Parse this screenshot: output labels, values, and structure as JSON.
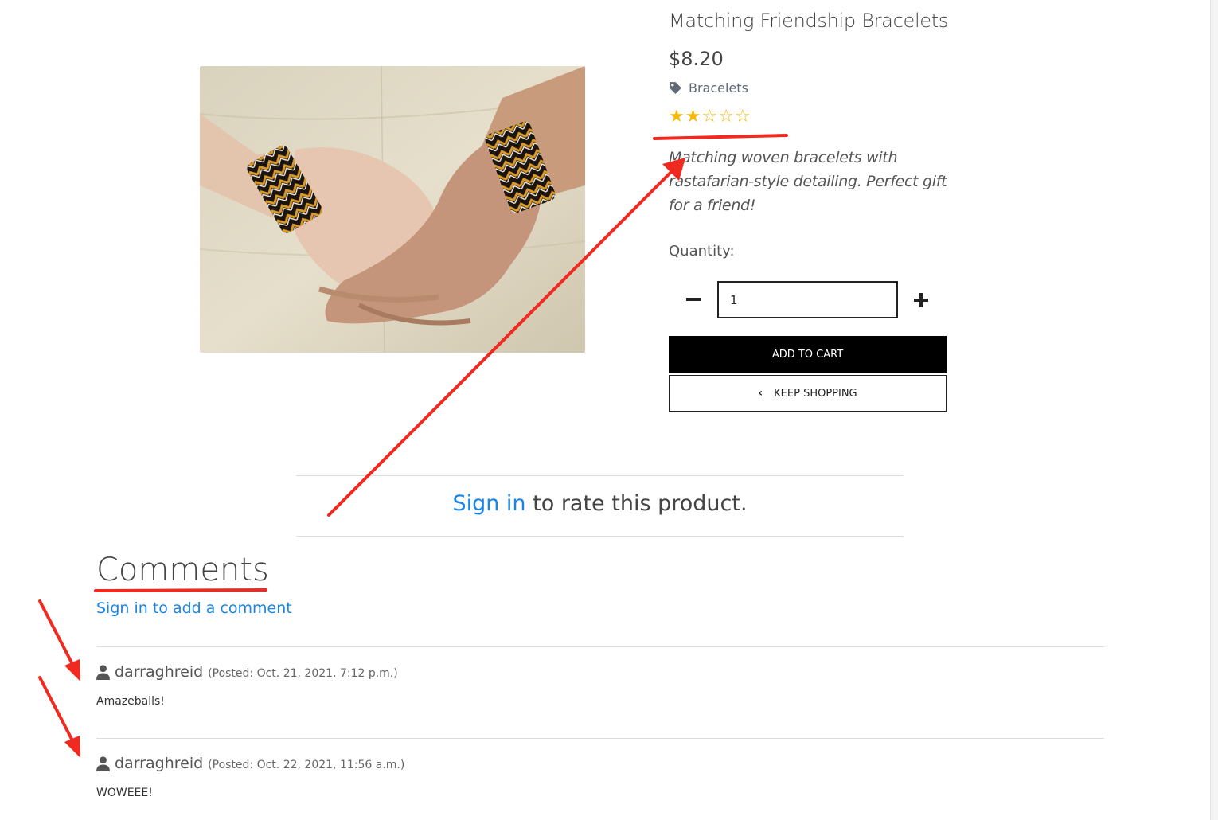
{
  "product": {
    "title": "Matching Friendship Bracelets",
    "price": "$8.20",
    "category": "Bracelets",
    "rating": 2,
    "rating_max": 5,
    "description": "Matching woven bracelets with rastafarian-style detailing. Perfect gift for a friend!",
    "image_alt": "Two hands wearing matching woven friendship bracelets"
  },
  "quantity": {
    "label": "Quantity:",
    "value": "1"
  },
  "buttons": {
    "add_to_cart": "ADD TO CART",
    "keep_shopping": "KEEP SHOPPING"
  },
  "rate": {
    "link_text": "Sign in",
    "rest_text": " to rate this product."
  },
  "comments": {
    "heading": "Comments",
    "add_link": "Sign in to add a comment",
    "items": [
      {
        "user": "darraghreid",
        "posted": "(Posted: Oct. 21, 2021, 7:12 p.m.)",
        "body": "Amazeballs!"
      },
      {
        "user": "darraghreid",
        "posted": "(Posted: Oct. 22, 2021, 11:56 a.m.)",
        "body": "WOWEEE!"
      }
    ]
  },
  "icons": {
    "category": "tag-icon",
    "user": "user-icon",
    "star_filled": "star-filled-icon",
    "star_empty": "star-empty-icon",
    "minus": "minus-icon",
    "plus": "plus-icon",
    "back": "chevron-left-icon"
  },
  "colors": {
    "link": "#1a84e8",
    "star": "#f5b90a",
    "annotation": "#f02a20"
  }
}
